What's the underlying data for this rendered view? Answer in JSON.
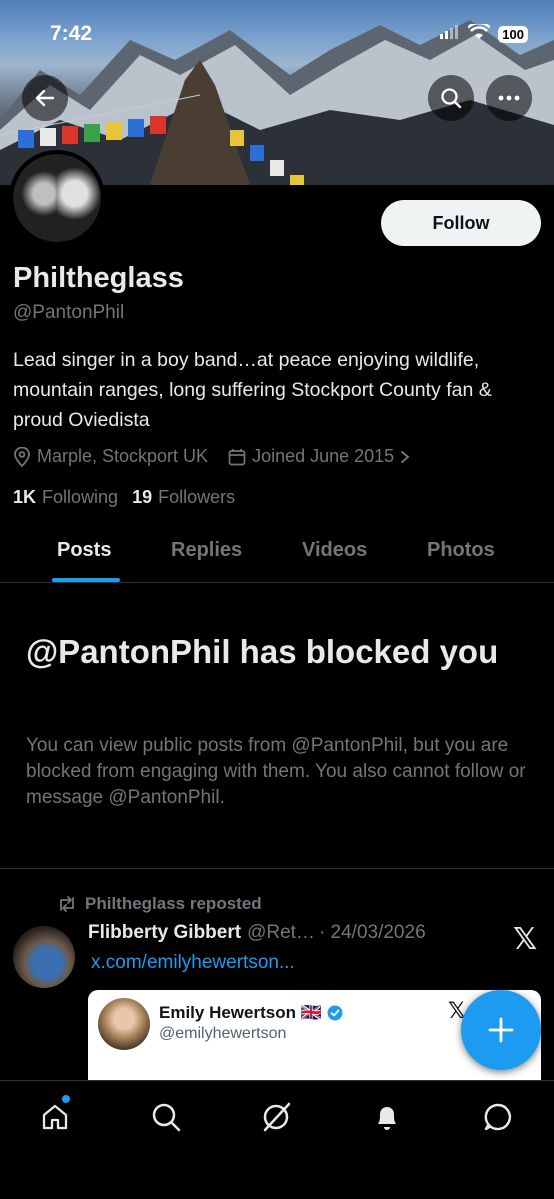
{
  "status_bar": {
    "time": "7:42",
    "battery": "100"
  },
  "profile": {
    "display_name": "Philtheglass",
    "handle": "@PantonPhil",
    "bio": "Lead singer in a boy band…at peace enjoying wildlife, mountain ranges, long suffering Stockport County fan & proud Oviedista",
    "location": "Marple, Stockport UK",
    "joined": "Joined June 2015",
    "following_count": "1K",
    "following_label": "Following",
    "followers_count": "19",
    "followers_label": "Followers",
    "follow_button": "Follow"
  },
  "tabs": [
    {
      "label": "Posts",
      "active": true
    },
    {
      "label": "Replies",
      "active": false
    },
    {
      "label": "Videos",
      "active": false
    },
    {
      "label": "Photos",
      "active": false
    }
  ],
  "blocked": {
    "title": "@PantonPhil has blocked you",
    "message": "You can view public posts from @PantonPhil, but you are blocked from engaging with them. You also cannot follow or message @PantonPhil."
  },
  "post": {
    "repost_label": "Philtheglass reposted",
    "author_name": "Flibberty Gibbert",
    "author_handle": "@Ret…",
    "date": "· 24/03/2026",
    "link": "x.com/emilyhewertson...",
    "embed": {
      "name": "Emily Hewertson 🇬🇧",
      "handle": "@emilyhewertson"
    }
  },
  "icons": {
    "back": "arrow-left-icon",
    "search": "search-icon",
    "more": "more-icon",
    "location": "location-pin-icon",
    "calendar": "calendar-icon",
    "repost": "repost-icon",
    "x_logo": "x-logo-icon",
    "verified": "verified-badge-icon",
    "compose": "plus-icon",
    "nav": [
      "home-icon",
      "search-icon",
      "grok-icon",
      "notifications-icon",
      "messages-icon"
    ]
  },
  "colors": {
    "accent": "#1d9bf0",
    "background": "#000000",
    "secondary_text": "#71767b"
  }
}
